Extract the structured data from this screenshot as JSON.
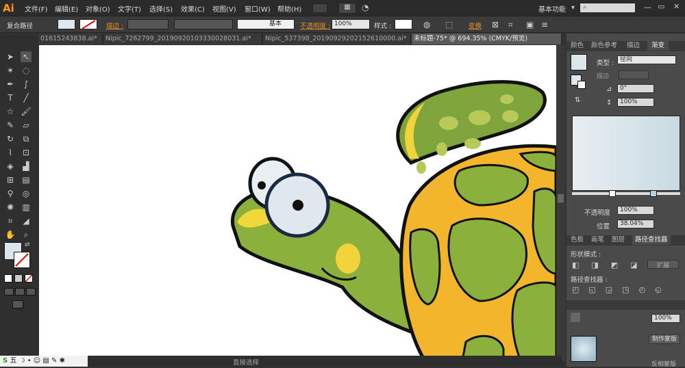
{
  "app": {
    "logo": "Ai"
  },
  "menu": [
    "文件(F)",
    "编辑(E)",
    "对象(O)",
    "文字(T)",
    "选择(S)",
    "效果(C)",
    "视图(V)",
    "窗口(W)",
    "帮助(H)"
  ],
  "workspace": "基本功能",
  "control": {
    "object_type": "复合路径",
    "stroke_label": "描边 :",
    "stroke_style": "基本",
    "opacity_label": "不透明度 :",
    "opacity_value": "100%",
    "style_label": "样式 :",
    "transform_label": "变换"
  },
  "tabs": [
    "01615243838.ai*",
    "Nipic_7262799_20190920103330028031.ai*",
    "Nipic_537398_20190929202152610000.ai*",
    "未标题-75* @ 694.35% (CMYK/预览)"
  ],
  "gradient_panel": {
    "tabs": [
      "颜色",
      "颜色参考",
      "描边",
      "渐变"
    ],
    "type_label": "类型 :",
    "type_value": "径向",
    "stroke_label": "描边",
    "angle_value": "0°",
    "aspect_value": "100%",
    "opacity_label": "不透明度",
    "opacity_value": "100%",
    "position_label": "位置",
    "position_value": "38.04%"
  },
  "pathfinder_panel": {
    "tabs": [
      "色板",
      "画笔",
      "图层",
      "路径查找器"
    ],
    "shape_modes": "形状模式 :",
    "expand": "扩展",
    "pathfinders": "路径查找器 :",
    "make_mask": "制作蒙版",
    "invert_mask": "反相蒙版",
    "opacity_value": "100%"
  },
  "status": {
    "tool": "直接选择"
  },
  "taskbar": {
    "ime": "五"
  },
  "colors": {
    "accent": "#e8902a",
    "shell_yellow": "#f3b52c",
    "turtle_green": "#8bb13c"
  }
}
